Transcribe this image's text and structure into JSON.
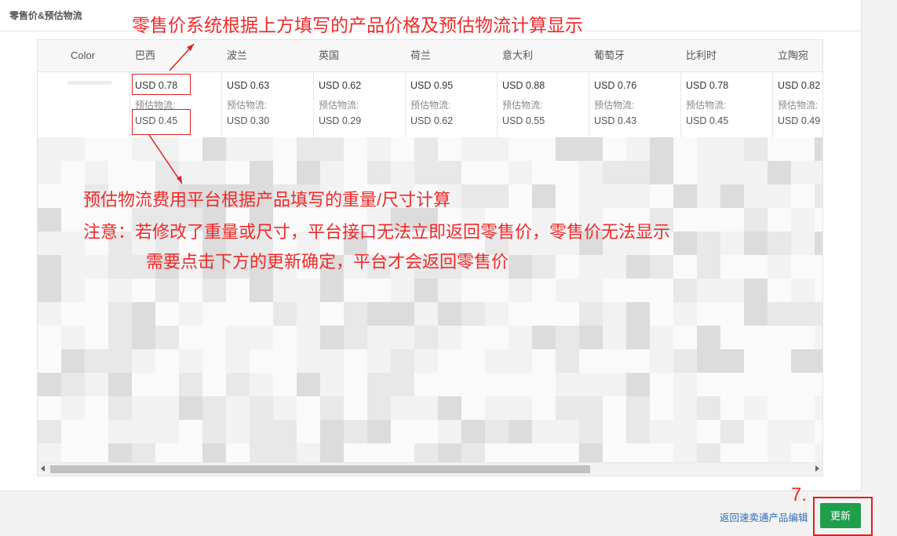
{
  "section": {
    "title": "零售价&预估物流"
  },
  "table": {
    "color_header": "Color",
    "columns": [
      {
        "name": "巴西",
        "price": "USD 0.78",
        "ship_label": "预估物流:",
        "ship": "USD 0.45"
      },
      {
        "name": "波兰",
        "price": "USD 0.63",
        "ship_label": "预估物流:",
        "ship": "USD 0.30"
      },
      {
        "name": "英国",
        "price": "USD 0.62",
        "ship_label": "预估物流:",
        "ship": "USD 0.29"
      },
      {
        "name": "荷兰",
        "price": "USD 0.95",
        "ship_label": "预估物流:",
        "ship": "USD 0.62"
      },
      {
        "name": "意大利",
        "price": "USD 0.88",
        "ship_label": "预估物流:",
        "ship": "USD 0.55"
      },
      {
        "name": "葡萄牙",
        "price": "USD 0.76",
        "ship_label": "预估物流:",
        "ship": "USD 0.43"
      },
      {
        "name": "比利时",
        "price": "USD 0.78",
        "ship_label": "预估物流:",
        "ship": "USD 0.45"
      },
      {
        "name": "立陶宛",
        "price": "USD 0.82",
        "ship_label": "预估物流:",
        "ship": "USD 0.49"
      }
    ]
  },
  "annotations": {
    "top": "零售价系统根据上方填写的产品价格及预估物流计算显示",
    "line1": "预估物流费用平台根据产品填写的重量/尺寸计算",
    "line2": "注意：若修改了重量或尺寸，平台接口无法立即返回零售价，零售价无法显示",
    "line3": "需要点击下方的更新确定，平台才会返回零售价",
    "step": "7."
  },
  "footer": {
    "back_link": "返回速卖通产品编辑",
    "update_button": "更新"
  },
  "colors": {
    "annotation": "#f02a2a",
    "button": "#1f9e4b",
    "link": "#2f6db5"
  }
}
